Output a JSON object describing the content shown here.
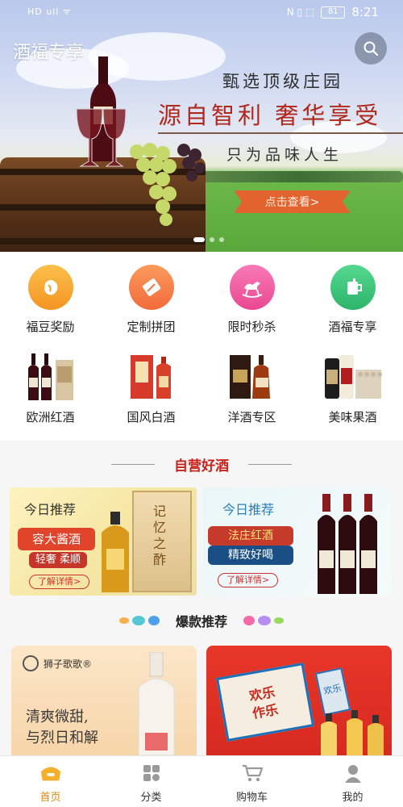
{
  "status_bar": {
    "carrier": "HD ull ᯤ",
    "icons": "N ▯ ⬚",
    "battery": "81",
    "time": "8:21"
  },
  "header": {
    "app_title": "酒福专享",
    "search_icon": "search-icon"
  },
  "banner": {
    "headline_top": "甄选顶级庄园",
    "headline_main": "源自智利 奢华享受",
    "headline_sub": "只为品味人生",
    "cta": "点击查看>",
    "slide_index": 1,
    "slide_count": 3
  },
  "shortcuts": [
    {
      "label": "福豆奖励",
      "icon": "bean-icon",
      "color": "#f7a531"
    },
    {
      "label": "定制拼团",
      "icon": "voucher-icon",
      "color": "#f57f48"
    },
    {
      "label": "限时秒杀",
      "icon": "rocking-horse-icon",
      "color": "#f25da3"
    },
    {
      "label": "酒福专享",
      "icon": "cup-icon",
      "color": "#3ec57b"
    }
  ],
  "categories": [
    {
      "label": "欧洲红酒",
      "icon": "red-wine-bottles"
    },
    {
      "label": "国风白酒",
      "icon": "baijiu-box"
    },
    {
      "label": "洋酒专区",
      "icon": "brandy-bottles"
    },
    {
      "label": "美味果酒",
      "icon": "beer-cans"
    }
  ],
  "self_operated": {
    "title": "自营好酒",
    "promos": [
      {
        "tag": "今日推荐",
        "pill1": "容大酱酒",
        "pill2": "轻奢 柔顺",
        "box_text": "记忆之酢",
        "link": "了解详情>"
      },
      {
        "tag": "今日推荐",
        "pill1": "法庄红酒",
        "pill2": "精致好喝",
        "link": "了解详情>"
      }
    ]
  },
  "hot": {
    "title": "爆款推荐",
    "cards": [
      {
        "brand": "狮子歌歌®",
        "slogan_line1": "清爽微甜,",
        "slogan_line2": "与烈日和解"
      },
      {
        "box_text": "欢乐作乐",
        "can_text": "欢乐"
      }
    ]
  },
  "tabbar": [
    {
      "label": "首页",
      "icon": "home-icon",
      "active": true
    },
    {
      "label": "分类",
      "icon": "category-icon",
      "active": false
    },
    {
      "label": "购物车",
      "icon": "cart-icon",
      "active": false
    },
    {
      "label": "我的",
      "icon": "profile-icon",
      "active": false
    }
  ]
}
